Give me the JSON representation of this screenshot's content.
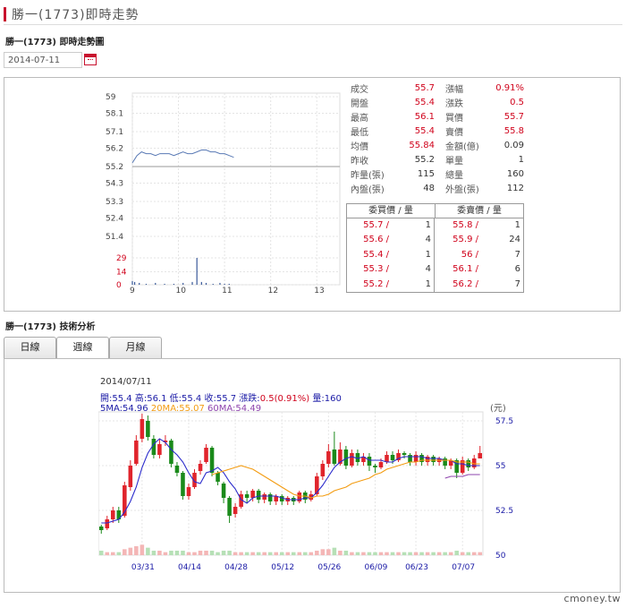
{
  "page": {
    "title": "勝一(1773)即時走勢",
    "sub_title_intraday": "勝一(1773) 即時走勢圖",
    "sub_title_tech": "勝一(1773) 技術分析",
    "date_value": "2014-07-11",
    "footer": "cmoney.tw"
  },
  "quote": {
    "rows": [
      {
        "l1": "成交",
        "v1": "55.7",
        "r1": true,
        "l2": "漲幅",
        "v2": "0.91%",
        "r2": true
      },
      {
        "l1": "開盤",
        "v1": "55.4",
        "r1": true,
        "l2": "漲跌",
        "v2": "0.5",
        "r2": true
      },
      {
        "l1": "最高",
        "v1": "56.1",
        "r1": true,
        "l2": "買價",
        "v2": "55.7",
        "r2": true
      },
      {
        "l1": "最低",
        "v1": "55.4",
        "r1": true,
        "l2": "賣價",
        "v2": "55.8",
        "r2": true
      },
      {
        "l1": "均價",
        "v1": "55.84",
        "r1": true,
        "l2": "金額(億)",
        "v2": "0.09",
        "r2": false
      },
      {
        "l1": "昨收",
        "v1": "55.2",
        "r1": false,
        "l2": "單量",
        "v2": "1",
        "r2": false
      },
      {
        "l1": "昨量(張)",
        "v1": "115",
        "r1": false,
        "l2": "總量",
        "v2": "160",
        "r2": false
      },
      {
        "l1": "內盤(張)",
        "v1": "48",
        "r1": false,
        "l2": "外盤(張)",
        "v2": "112",
        "r2": false
      }
    ],
    "order_head": {
      "buy": "委買價 / 量",
      "sell": "委賣價 / 量"
    },
    "orders": [
      {
        "bp": "55.7 /",
        "bv": "1",
        "sp": "55.8 /",
        "sv": "1"
      },
      {
        "bp": "55.6 /",
        "bv": "4",
        "sp": "55.9 /",
        "sv": "24"
      },
      {
        "bp": "55.4 /",
        "bv": "1",
        "sp": "56 /",
        "sv": "7"
      },
      {
        "bp": "55.3 /",
        "bv": "4",
        "sp": "56.1 /",
        "sv": "6"
      },
      {
        "bp": "55.2 /",
        "bv": "1",
        "sp": "56.2 /",
        "sv": "7"
      }
    ]
  },
  "tabs": [
    "日線",
    "週線",
    "月線"
  ],
  "kline_info": {
    "date": "2014/07/11",
    "line2": [
      {
        "t": "開:",
        "c": "#1a1aa6"
      },
      {
        "t": "55.4",
        "c": "#1a1aa6"
      },
      {
        "t": " 高:",
        "c": "#1a1aa6"
      },
      {
        "t": "56.1",
        "c": "#1a1aa6"
      },
      {
        "t": " 低:",
        "c": "#1a1aa6"
      },
      {
        "t": "55.4",
        "c": "#1a1aa6"
      },
      {
        "t": " 收:",
        "c": "#1a1aa6"
      },
      {
        "t": "55.7",
        "c": "#1a1aa6"
      },
      {
        "t": " 漲跌:",
        "c": "#1a1aa6"
      },
      {
        "t": "0.5(0.91%)",
        "c": "#d0021b"
      },
      {
        "t": " 量:",
        "c": "#1a1aa6"
      },
      {
        "t": "160",
        "c": "#1a1aa6"
      }
    ],
    "line3": [
      {
        "t": "5MA:54.96",
        "c": "#1a1aa6"
      },
      {
        "t": " 20MA:55.07",
        "c": "#f39c12"
      },
      {
        "t": " 60MA:54.49",
        "c": "#8e44ad"
      }
    ],
    "unit": "(元)"
  },
  "chart_data": [
    {
      "type": "line",
      "name": "intraday",
      "price_ticks": [
        "59",
        "58.1",
        "57.1",
        "56.2",
        "55.2",
        "54.3",
        "53.3",
        "52.4",
        "51.4"
      ],
      "volume_ticks": [
        "29",
        "14",
        "0"
      ],
      "x_ticks": [
        "9",
        "10",
        "11",
        "12",
        "13"
      ],
      "prev_close": 55.2,
      "ylim": [
        51.4,
        59
      ],
      "price_x": [
        9.0,
        9.05,
        9.1,
        9.2,
        9.3,
        9.4,
        9.5,
        9.6,
        9.7,
        9.8,
        9.9,
        10.0,
        10.1,
        10.2,
        10.3,
        10.4,
        10.5,
        10.6,
        10.7,
        10.8,
        10.9,
        11.0,
        11.1,
        11.2
      ],
      "price": [
        55.4,
        55.6,
        55.8,
        56.0,
        55.9,
        55.9,
        55.8,
        55.9,
        55.9,
        55.9,
        55.8,
        55.9,
        56.0,
        55.9,
        55.9,
        56.0,
        56.1,
        56.1,
        56.0,
        56.0,
        55.9,
        55.9,
        55.8,
        55.7
      ],
      "vol_x": [
        9.0,
        9.05,
        9.15,
        9.3,
        9.5,
        9.7,
        9.9,
        10.1,
        10.3,
        10.4,
        10.5,
        10.6,
        10.75,
        10.9,
        11.0,
        11.1
      ],
      "vol": [
        4,
        3,
        2,
        1,
        2,
        1,
        1,
        2,
        3,
        29,
        3,
        2,
        1,
        2,
        1,
        1
      ]
    },
    {
      "type": "bar",
      "name": "daily-candlestick",
      "x_ticks": [
        "03/31",
        "04/14",
        "04/28",
        "05/12",
        "05/26",
        "06/09",
        "06/23",
        "07/07"
      ],
      "y_ticks": [
        "57.5",
        "55",
        "52.5",
        "50"
      ],
      "ylim": [
        50,
        58
      ],
      "series": [
        {
          "name": "5MA",
          "values": [
            54.96
          ]
        },
        {
          "name": "20MA",
          "values": [
            55.07
          ]
        },
        {
          "name": "60MA",
          "values": [
            54.49
          ]
        }
      ],
      "candles": [
        [
          51.6,
          51.4,
          51.7,
          51.2
        ],
        [
          51.5,
          52.0,
          52.2,
          51.4
        ],
        [
          52.0,
          52.5,
          52.7,
          51.8
        ],
        [
          52.5,
          52.0,
          52.7,
          51.8
        ],
        [
          52.2,
          53.9,
          54.1,
          52.1
        ],
        [
          53.8,
          55.0,
          55.3,
          53.6
        ],
        [
          55.1,
          56.4,
          56.7,
          55.0
        ],
        [
          56.5,
          57.6,
          57.9,
          56.3
        ],
        [
          57.5,
          56.6,
          57.8,
          56.4
        ],
        [
          56.5,
          55.6,
          56.7,
          55.4
        ],
        [
          55.6,
          56.2,
          56.5,
          55.4
        ],
        [
          56.3,
          56.4,
          56.7,
          56.1
        ],
        [
          56.4,
          55.1,
          56.5,
          54.9
        ],
        [
          55.0,
          54.6,
          55.2,
          54.4
        ],
        [
          54.6,
          53.3,
          54.7,
          53.1
        ],
        [
          53.3,
          53.8,
          54.0,
          53.1
        ],
        [
          53.8,
          54.6,
          54.8,
          53.7
        ],
        [
          54.7,
          55.1,
          55.3,
          54.5
        ],
        [
          55.2,
          56.0,
          56.2,
          55.1
        ],
        [
          56.0,
          54.6,
          56.1,
          54.4
        ],
        [
          54.6,
          54.1,
          54.7,
          53.9
        ],
        [
          54.0,
          53.2,
          54.1,
          52.9
        ],
        [
          53.2,
          52.2,
          53.3,
          51.8
        ],
        [
          52.3,
          52.7,
          52.9,
          52.1
        ],
        [
          52.7,
          53.4,
          53.6,
          52.6
        ],
        [
          53.4,
          53.2,
          53.6,
          52.9
        ],
        [
          53.2,
          53.6,
          53.7,
          53.0
        ],
        [
          53.6,
          53.1,
          53.7,
          52.9
        ],
        [
          53.1,
          53.4,
          53.5,
          52.9
        ],
        [
          53.4,
          53.0,
          53.5,
          52.8
        ],
        [
          53.0,
          53.3,
          53.4,
          52.8
        ],
        [
          53.3,
          53.0,
          53.4,
          52.8
        ],
        [
          53.0,
          53.2,
          53.3,
          52.8
        ],
        [
          53.2,
          53.0,
          53.3,
          52.8
        ],
        [
          53.0,
          53.5,
          53.6,
          52.9
        ],
        [
          53.5,
          53.1,
          53.6,
          52.9
        ],
        [
          53.1,
          53.4,
          53.6,
          53.0
        ],
        [
          53.4,
          54.4,
          54.6,
          53.3
        ],
        [
          54.4,
          55.1,
          55.3,
          54.2
        ],
        [
          55.1,
          55.8,
          56.2,
          54.9
        ],
        [
          55.9,
          55.1,
          56.9,
          55.0
        ],
        [
          55.1,
          55.9,
          56.3,
          55.0
        ],
        [
          55.9,
          55.0,
          56.1,
          54.8
        ],
        [
          55.0,
          55.7,
          55.9,
          54.9
        ],
        [
          55.7,
          55.2,
          55.9,
          55.0
        ],
        [
          55.2,
          55.5,
          55.7,
          55.0
        ],
        [
          55.5,
          55.0,
          55.7,
          54.7
        ],
        [
          55.0,
          54.9,
          55.1,
          54.6
        ],
        [
          54.9,
          55.2,
          55.4,
          54.8
        ],
        [
          55.2,
          55.6,
          55.8,
          55.1
        ],
        [
          55.6,
          55.3,
          55.8,
          55.1
        ],
        [
          55.3,
          55.7,
          55.9,
          55.2
        ],
        [
          55.7,
          55.6,
          55.8,
          55.4
        ],
        [
          55.6,
          55.2,
          55.7,
          55.0
        ],
        [
          55.2,
          55.6,
          55.8,
          55.0
        ],
        [
          55.6,
          55.2,
          55.7,
          55.0
        ],
        [
          55.2,
          55.5,
          55.6,
          55.0
        ],
        [
          55.5,
          55.2,
          55.6,
          55.0
        ],
        [
          55.2,
          55.4,
          55.5,
          55.0
        ],
        [
          55.4,
          55.0,
          55.5,
          54.8
        ],
        [
          55.0,
          55.3,
          55.4,
          54.8
        ],
        [
          55.3,
          54.6,
          55.4,
          54.3
        ],
        [
          54.6,
          55.3,
          55.5,
          54.5
        ],
        [
          55.3,
          54.9,
          55.4,
          54.7
        ],
        [
          54.9,
          55.4,
          55.6,
          54.8
        ],
        [
          55.4,
          55.7,
          56.1,
          55.4
        ]
      ],
      "ma5": [
        51.8,
        51.8,
        51.9,
        52.0,
        52.4,
        53.0,
        53.8,
        54.9,
        55.7,
        56.2,
        56.5,
        56.3,
        55.9,
        55.6,
        55.2,
        54.6,
        54.1,
        54.0,
        54.6,
        54.7,
        54.9,
        54.6,
        54.1,
        53.7,
        53.1,
        52.9,
        53.2,
        53.3,
        53.3,
        53.3,
        53.3,
        53.2,
        53.1,
        53.1,
        53.1,
        53.2,
        53.2,
        53.5,
        53.9,
        54.4,
        54.9,
        55.2,
        55.4,
        55.5,
        55.4,
        55.5,
        55.3,
        55.3,
        55.3,
        55.2,
        55.2,
        55.4,
        55.5,
        55.5,
        55.5,
        55.5,
        55.4,
        55.4,
        55.4,
        55.3,
        55.3,
        55.1,
        55.1,
        55.0,
        55.0,
        55.0
      ],
      "ma20": [
        null,
        null,
        null,
        null,
        null,
        null,
        null,
        null,
        null,
        null,
        null,
        null,
        null,
        null,
        null,
        null,
        null,
        null,
        null,
        54.5,
        54.6,
        54.7,
        54.8,
        54.9,
        55.0,
        54.9,
        54.8,
        54.6,
        54.4,
        54.2,
        54.0,
        53.8,
        53.6,
        53.4,
        53.3,
        53.3,
        53.2,
        53.3,
        53.3,
        53.4,
        53.6,
        53.7,
        53.8,
        54.0,
        54.1,
        54.2,
        54.3,
        54.5,
        54.6,
        54.8,
        54.9,
        55.0,
        55.1,
        55.2,
        55.2,
        55.3,
        55.3,
        55.3,
        55.3,
        55.3,
        55.3,
        55.2,
        55.2,
        55.2,
        55.1,
        55.1
      ],
      "ma60": [
        null,
        null,
        null,
        null,
        null,
        null,
        null,
        null,
        null,
        null,
        null,
        null,
        null,
        null,
        null,
        null,
        null,
        null,
        null,
        null,
        null,
        null,
        null,
        null,
        null,
        null,
        null,
        null,
        null,
        null,
        null,
        null,
        null,
        null,
        null,
        null,
        null,
        null,
        null,
        null,
        null,
        null,
        null,
        null,
        null,
        null,
        null,
        null,
        null,
        null,
        null,
        null,
        null,
        null,
        null,
        null,
        null,
        null,
        null,
        54.3,
        54.4,
        54.4,
        54.4,
        54.5,
        54.5,
        54.5
      ],
      "volume": [
        3,
        2,
        2,
        2,
        4,
        5,
        6,
        7,
        5,
        3,
        3,
        2,
        3,
        3,
        3,
        2,
        2,
        3,
        3,
        3,
        2,
        3,
        3,
        2,
        2,
        2,
        2,
        2,
        2,
        2,
        2,
        2,
        2,
        2,
        2,
        2,
        2,
        3,
        4,
        4,
        5,
        3,
        3,
        2,
        2,
        2,
        2,
        2,
        2,
        2,
        2,
        2,
        2,
        2,
        2,
        2,
        2,
        2,
        2,
        2,
        2,
        3,
        2,
        2,
        2,
        2
      ]
    }
  ]
}
